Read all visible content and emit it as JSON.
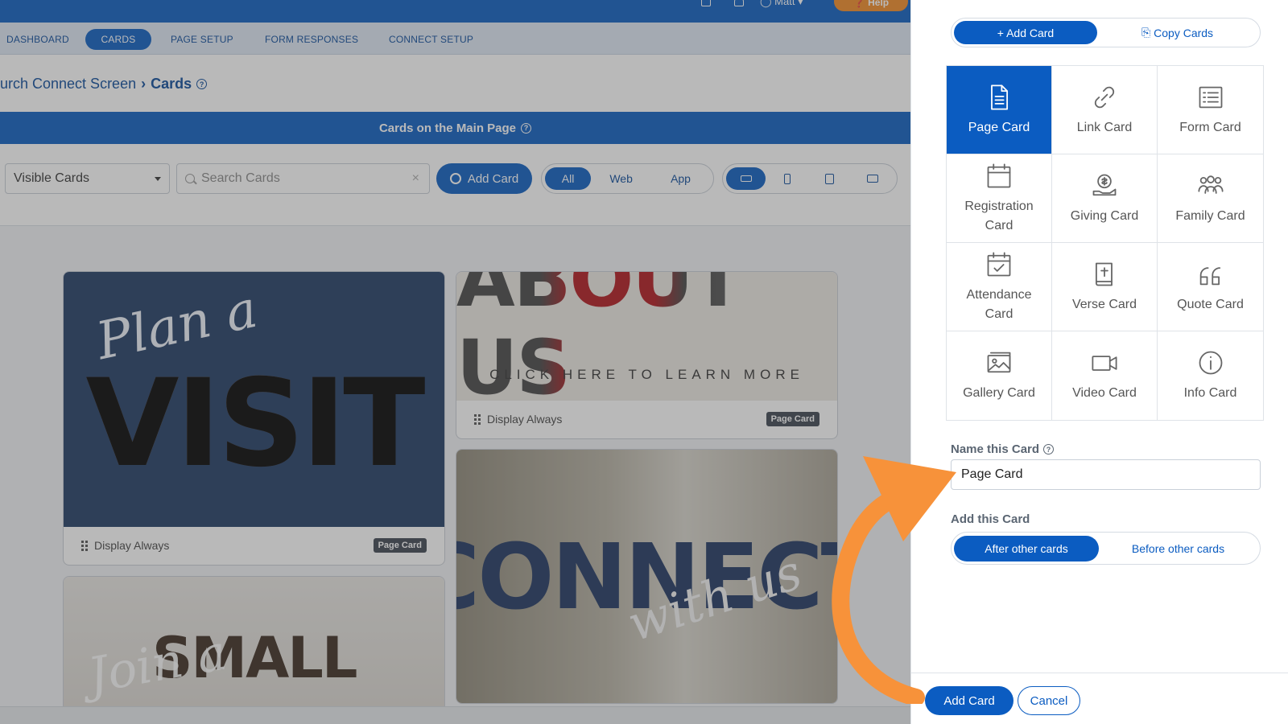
{
  "topbar": {
    "user": "Matt",
    "help_label": "Help"
  },
  "nav": [
    {
      "label": "DASHBOARD"
    },
    {
      "label": "CARDS"
    },
    {
      "label": "PAGE SETUP"
    },
    {
      "label": "FORM RESPONSES"
    },
    {
      "label": "CONNECT SETUP"
    }
  ],
  "breadcrumb": {
    "parent": "urch Connect Screen",
    "current": "Cards"
  },
  "section_title": "Cards on the Main Page",
  "toolbar": {
    "filter_value": "Visible Cards",
    "search_placeholder": "Search Cards",
    "add_card_label": "Add Card",
    "platform": [
      "All",
      "Web",
      "App"
    ]
  },
  "cards": {
    "visit": {
      "script": "Plan a",
      "big": "VISIT",
      "footer": "Display Always",
      "tag": "Page Card"
    },
    "about": {
      "big": "ABOUT US",
      "sub": "CLICK HERE TO LEARN MORE",
      "footer": "Display Always",
      "tag": "Page Card"
    },
    "connect": {
      "big": "CONNECT",
      "script": "with us"
    },
    "small": {
      "big": "SMALL",
      "script": "Join a"
    }
  },
  "panel": {
    "tab_add": "+ Add Card",
    "tab_copy": "Copy Cards",
    "types": [
      {
        "label": "Page Card",
        "icon": "page-icon"
      },
      {
        "label": "Link Card",
        "icon": "link-icon"
      },
      {
        "label": "Form Card",
        "icon": "form-icon"
      },
      {
        "label": "Registration Card",
        "icon": "calendar-icon"
      },
      {
        "label": "Giving Card",
        "icon": "giving-icon"
      },
      {
        "label": "Family Card",
        "icon": "family-icon"
      },
      {
        "label": "Attendance Card",
        "icon": "attendance-icon"
      },
      {
        "label": "Verse Card",
        "icon": "bible-icon"
      },
      {
        "label": "Quote Card",
        "icon": "quote-icon"
      },
      {
        "label": "Gallery Card",
        "icon": "gallery-icon"
      },
      {
        "label": "Video Card",
        "icon": "video-icon"
      },
      {
        "label": "Info Card",
        "icon": "info-icon"
      }
    ],
    "name_label": "Name this Card",
    "name_value": "Page Card",
    "add_label": "Add this Card",
    "pos_after": "After other cards",
    "pos_before": "Before other cards",
    "btn_add": "Add Card",
    "btn_cancel": "Cancel"
  },
  "colors": {
    "brand": "#0b5cc1",
    "accent": "#f08a24",
    "arrow": "#f7923a"
  }
}
